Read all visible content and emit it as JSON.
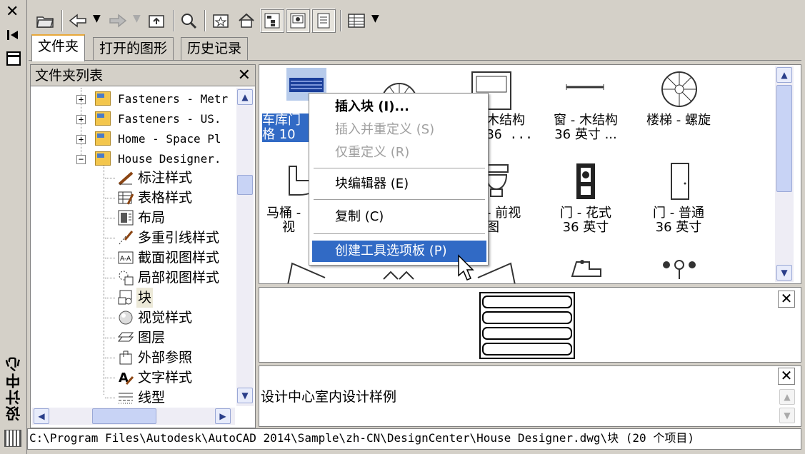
{
  "palette": {
    "title": "设计中心",
    "close": "✕"
  },
  "toolbar": {
    "buttons": [
      "load-icon",
      "back-icon",
      "forward-icon",
      "up-icon",
      "search-icon",
      "favorites-icon",
      "home-icon",
      "tree-toggle-icon",
      "preview-icon",
      "description-icon",
      "views-icon"
    ]
  },
  "tabs": [
    {
      "label": "文件夹",
      "active": true
    },
    {
      "label": "打开的图形",
      "active": false
    },
    {
      "label": "历史记录",
      "active": false
    }
  ],
  "folder_panel": {
    "title": "文件夹列表",
    "close": "✕",
    "tree": [
      {
        "label": "Fasteners - Metr",
        "expander": "+"
      },
      {
        "label": "Fasteners - US.",
        "expander": "+"
      },
      {
        "label": "Home - Space Pl",
        "expander": "+"
      },
      {
        "label": "House Designer.",
        "expander": "−"
      }
    ],
    "children": [
      "标注样式",
      "表格样式",
      "布局",
      "多重引线样式",
      "截面视图样式",
      "局部视图样式",
      "块",
      "视觉样式",
      "图层",
      "外部参照",
      "文字样式",
      "线型"
    ]
  },
  "content": {
    "items": [
      {
        "line1": "车库门",
        "line2": "格 10",
        "selected": true
      },
      {
        "line1": "",
        "line2": ""
      },
      {
        "line1": "木结构",
        "line2": "36 ..."
      },
      {
        "line1": "窗 - 木结构",
        "line2": "36 英寸 ..."
      },
      {
        "line1": "楼梯 - 螺旋",
        "line2": ""
      },
      {
        "line1": "马桶 -",
        "line2": "视"
      },
      {
        "line1": "",
        "line2": ""
      },
      {
        "line1": "- 前视",
        "line2": "图"
      },
      {
        "line1": "门 - 花式",
        "line2": "36 英寸"
      },
      {
        "line1": "门 - 普通",
        "line2": "36 英寸"
      }
    ]
  },
  "context_menu": {
    "items": [
      {
        "label": "插入块 (I)...",
        "enabled": true,
        "bold": true
      },
      {
        "label": "插入并重定义 (S)",
        "enabled": false
      },
      {
        "label": "仅重定义 (R)",
        "enabled": false
      },
      {
        "label": "块编辑器 (E)",
        "enabled": true
      },
      {
        "label": "复制 (C)",
        "enabled": true
      },
      {
        "label": "创建工具选项板 (P)",
        "enabled": true,
        "highlighted": true
      }
    ]
  },
  "preview": {
    "close": "✕"
  },
  "description": {
    "text": "设计中心室内设计样例",
    "close": "✕"
  },
  "status": {
    "path": "C:\\Program Files\\Autodesk\\AutoCAD 2014\\Sample\\zh-CN\\DesignCenter\\House Designer.dwg\\块 (20 个项目)"
  },
  "colors": {
    "highlight": "#316ac5",
    "tab_accent": "#e8a83a",
    "folder": "#f3c64d"
  }
}
